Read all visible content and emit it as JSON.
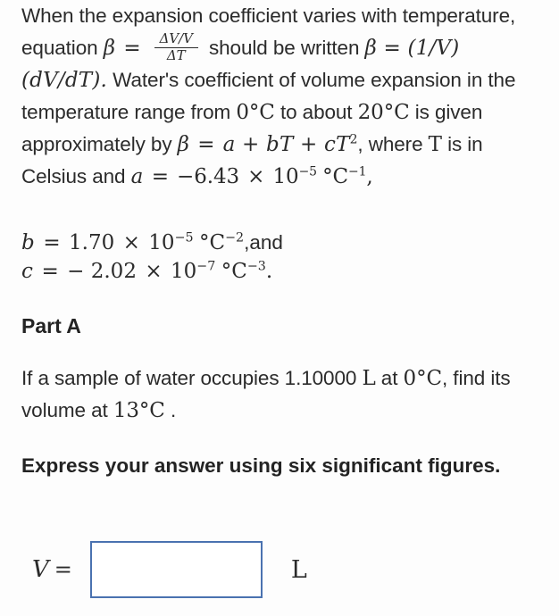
{
  "problem": {
    "intro": {
      "s1": "When the expansion coefficient varies with temperature, equation",
      "beta1": "β",
      "eq1": "=",
      "fraction": {
        "numerator": "ΔV/V",
        "denominator": "ΔT"
      },
      "s2": "should be written",
      "beta2": "β = (1/V)(dV/dT).",
      "s3": "Water's coefficient of volume expansion in the temperature range from",
      "t_low": "0",
      "deg_c_1": "°C",
      "s4": "to about",
      "t_high": "20",
      "deg_c_2": "°C",
      "s5": "is given approximately by",
      "beta_formula_lhs": "β",
      "beta_formula_eq": "=",
      "beta_formula_rhs": "a + bT + cT",
      "beta_formula_exp": "2",
      "s6": ", where",
      "var_T": "T",
      "s7": "is in Celsius and"
    },
    "constants": {
      "a": {
        "symbol": "a",
        "equals": "=",
        "mantissa": "−6.43",
        "times": "×",
        "base": "10",
        "exponent": "−5",
        "unit": "°C",
        "unit_exponent": "−1",
        "trailing": ","
      },
      "b": {
        "symbol": "b",
        "equals": "=",
        "mantissa": "1.70",
        "times": "×",
        "base": "10",
        "exponent": "−5",
        "unit": "°C",
        "unit_exponent": "−2",
        "trailing": ",and"
      },
      "c": {
        "symbol": "c",
        "equals": "=",
        "mantissa": "− 2.02",
        "times": "×",
        "base": "10",
        "exponent": "−7",
        "unit": "°C",
        "unit_exponent": "−3",
        "trailing": "."
      }
    }
  },
  "part": {
    "heading": "Part A",
    "question_pre": "If a sample of water occupies",
    "volume_initial": "1.10000",
    "volume_unit": "L",
    "question_mid": "at",
    "temp_initial": "0",
    "deg_c_initial": "°C",
    "question_mid2": ", find its volume at",
    "temp_final": "13",
    "deg_c_final": "°C",
    "question_end": ".",
    "instruction": "Express your answer using six significant figures."
  },
  "answer": {
    "variable": "V",
    "equals": "=",
    "value": "",
    "placeholder": "",
    "unit": "L",
    "border_color": "#4a72b0"
  },
  "colors": {
    "background": "#fdfdfd",
    "text": "#2b2b2b",
    "input_border": "#4a72b0"
  }
}
